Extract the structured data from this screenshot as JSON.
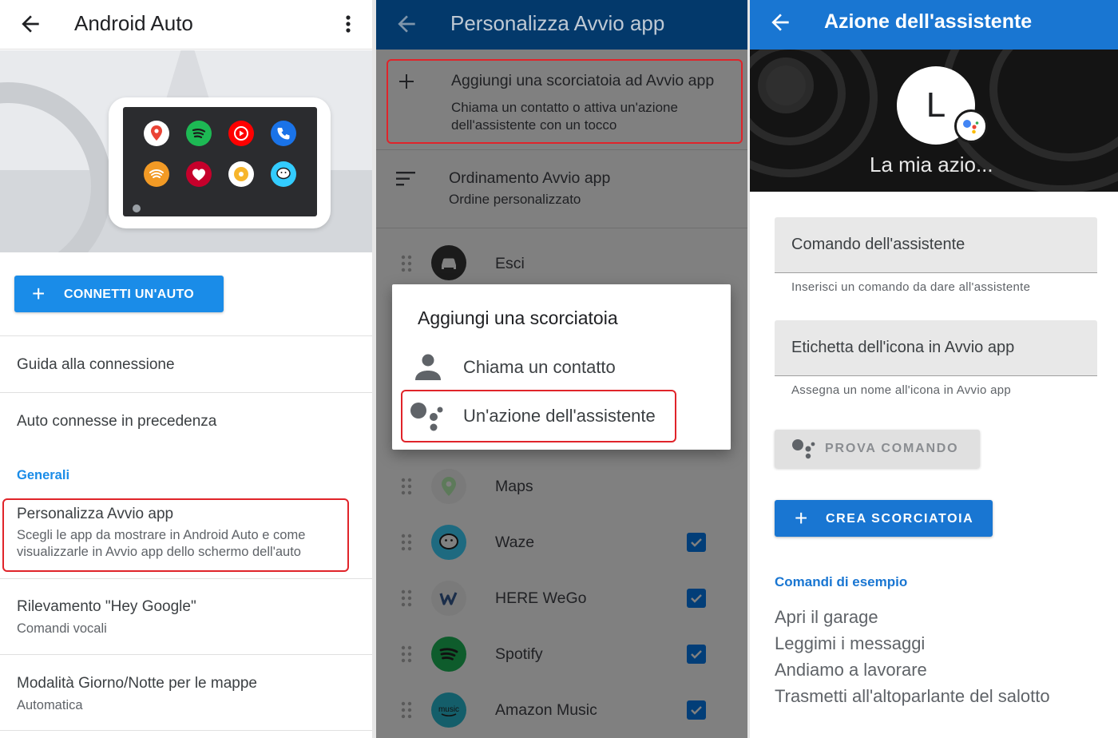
{
  "colors": {
    "primary_blue": "#1a8ce8",
    "dark_blue_bar": "#03396b",
    "assistant_bar": "#1976d2",
    "highlight_red": "#e0242a",
    "scrim_gray": "#808080"
  },
  "panel1": {
    "title": "Android Auto",
    "back_icon": "arrow-back-icon",
    "menu_icon": "more-vert-icon",
    "connect_button": "CONNETTI UN'AUTO",
    "items": [
      {
        "primary": "Guida alla connessione"
      },
      {
        "primary": "Auto connesse in precedenza"
      }
    ],
    "section_header": "Generali",
    "customize": {
      "primary": "Personalizza Avvio app",
      "secondary_1": "Scegli le app da mostrare in Android Auto e come",
      "secondary_2": "visualizzarle in Avvio app dello schermo dell'auto"
    },
    "hey_google": {
      "primary": "Rilevamento \"Hey Google\"",
      "secondary": "Comandi vocali"
    },
    "day_night": {
      "primary": "Modalità Giorno/Notte per le mappe",
      "secondary": "Automatica"
    }
  },
  "panel2": {
    "title": "Personalizza Avvio app",
    "add_shortcut": {
      "title": "Aggiungi una scorciatoia ad Avvio app",
      "line1": "Chiama un contatto o attiva un'azione",
      "line2": "dell'assistente con un tocco"
    },
    "sort": {
      "title": "Ordinamento Avvio app",
      "subtitle": "Ordine personalizzato"
    },
    "apps": [
      {
        "label": "Esci",
        "checked": false
      },
      {
        "label": "Maps",
        "checked": false
      },
      {
        "label": "Waze",
        "checked": true
      },
      {
        "label": "HERE WeGo",
        "checked": true
      },
      {
        "label": "Spotify",
        "checked": true
      },
      {
        "label": "Amazon Music",
        "checked": true
      }
    ],
    "dialog": {
      "title": "Aggiungi una scorciatoia",
      "option_contact": "Chiama un contatto",
      "option_assistant": "Un'azione dell'assistente"
    }
  },
  "panel3": {
    "title": "Azione dell'assistente",
    "avatar_letter": "L",
    "hero_label": "La mia azio...",
    "command_field": {
      "placeholder": "Comando dell'assistente",
      "helper": "Inserisci un comando da dare all'assistente"
    },
    "label_field": {
      "placeholder": "Etichetta dell'icona in Avvio app",
      "helper": "Assegna un nome all'icona in Avvio app"
    },
    "try_button": "PROVA COMANDO",
    "create_button": "CREA SCORCIATOIA",
    "examples_header": "Comandi di esempio",
    "examples": [
      "Apri il garage",
      "Leggimi i messaggi",
      "Andiamo a lavorare",
      "Trasmetti all'altoparlante del salotto"
    ]
  }
}
